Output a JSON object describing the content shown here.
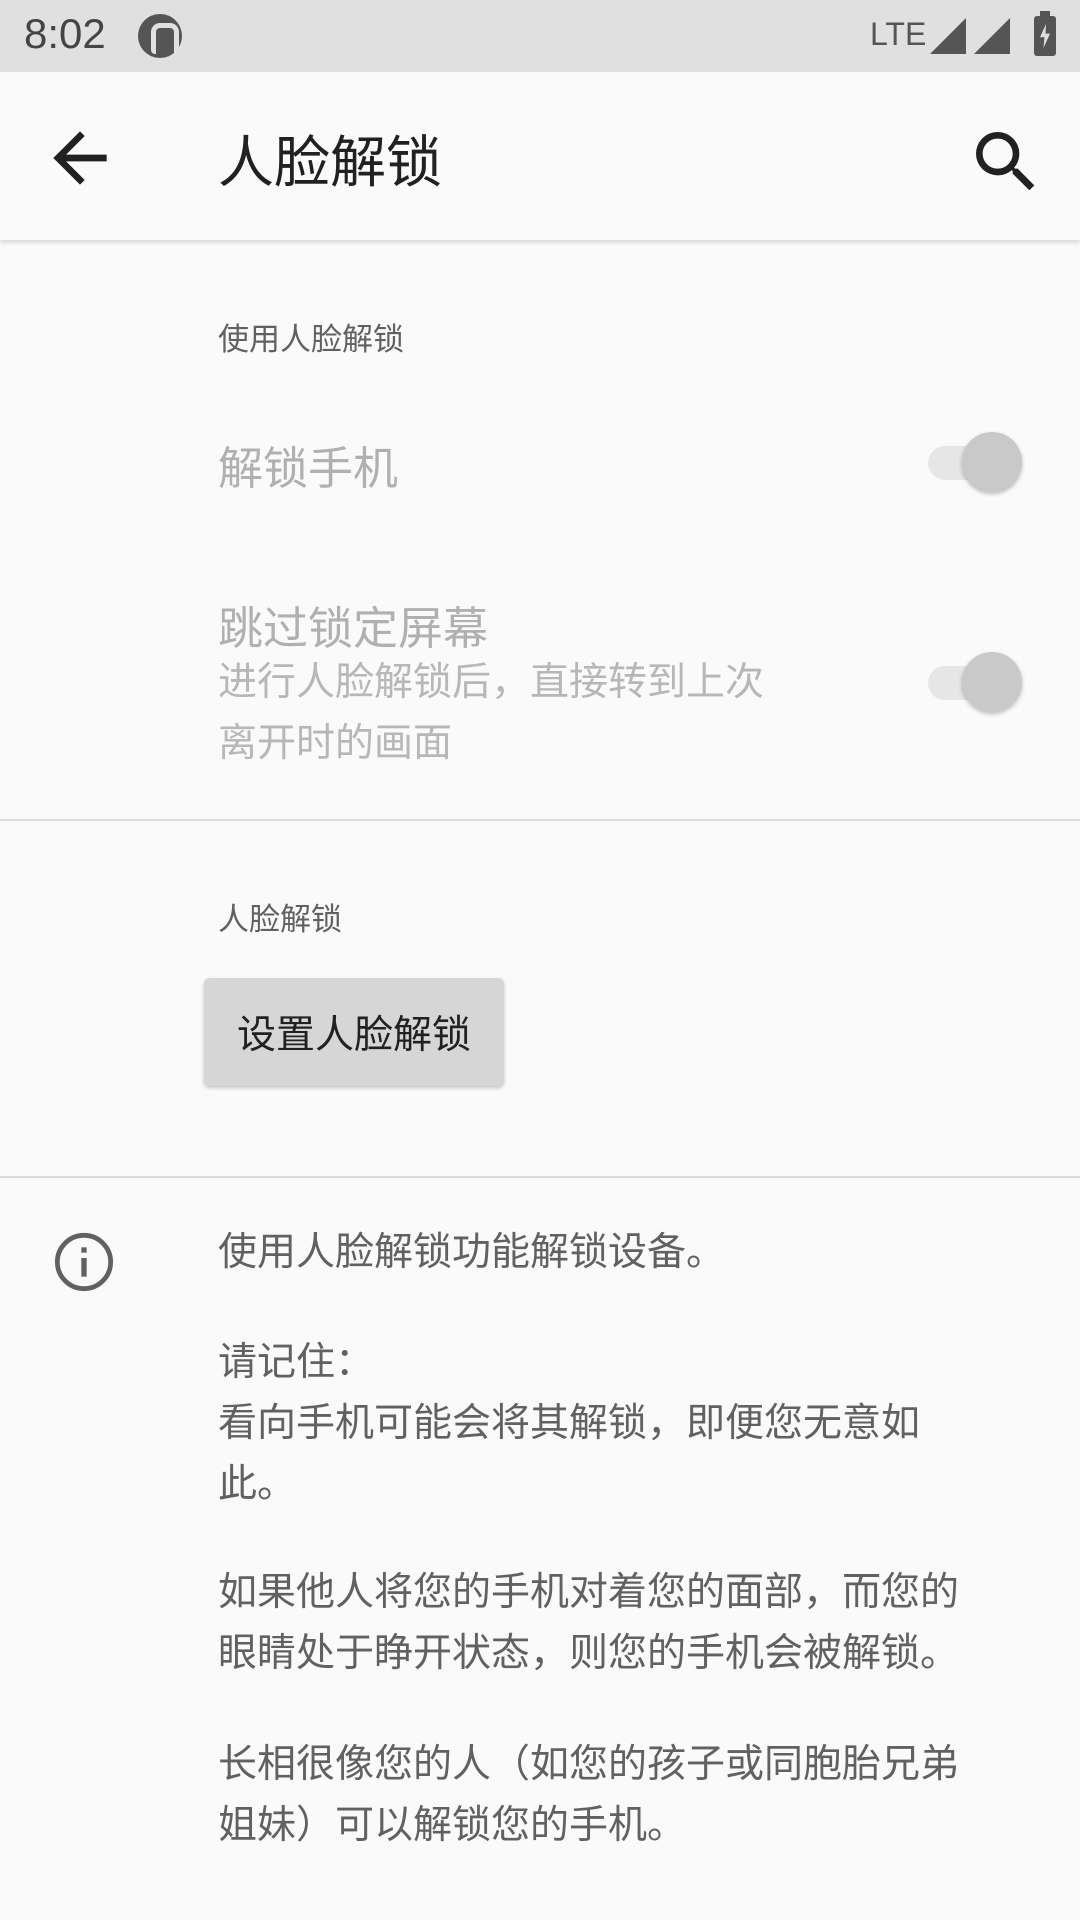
{
  "status_bar": {
    "time": "8:02",
    "network": "LTE",
    "icons": [
      "app-notification-icon",
      "signal-icon",
      "signal-icon",
      "battery-charging-icon"
    ]
  },
  "app_bar": {
    "title": "人脸解锁",
    "back_icon": "arrow-back-icon",
    "search_icon": "search-icon"
  },
  "section_use": {
    "header": "使用人脸解锁",
    "unlock_phone": {
      "title": "解锁手机"
    },
    "skip_lock_screen": {
      "title": "跳过锁定屏幕",
      "summary_line1": "进行人脸解锁后，直接转到上次",
      "summary_line2": "离开时的画面"
    }
  },
  "section_face_unlock": {
    "header": "人脸解锁",
    "setup_button": "设置人脸解锁"
  },
  "info": {
    "icon": "info-icon",
    "p1": "使用人脸解锁功能解锁设备。",
    "p2_line1": "请记住：",
    "p2_line2": "看向手机可能会将其解锁，即便您无意如",
    "p2_line3": "此。",
    "p3_line1": "如果他人将您的手机对着您的面部，而您的",
    "p3_line2": "眼睛处于睁开状态，则您的手机会被解锁。",
    "p4_line1": "长相很像您的人（如您的孩子或同胞胎兄弟",
    "p4_line2": "姐妹）可以解锁您的手机。"
  },
  "colors": {
    "background": "#fafafa",
    "status_bar": "#e0e0e0",
    "disabled_text": "#b0b0b0",
    "secondary_text": "#616161"
  }
}
